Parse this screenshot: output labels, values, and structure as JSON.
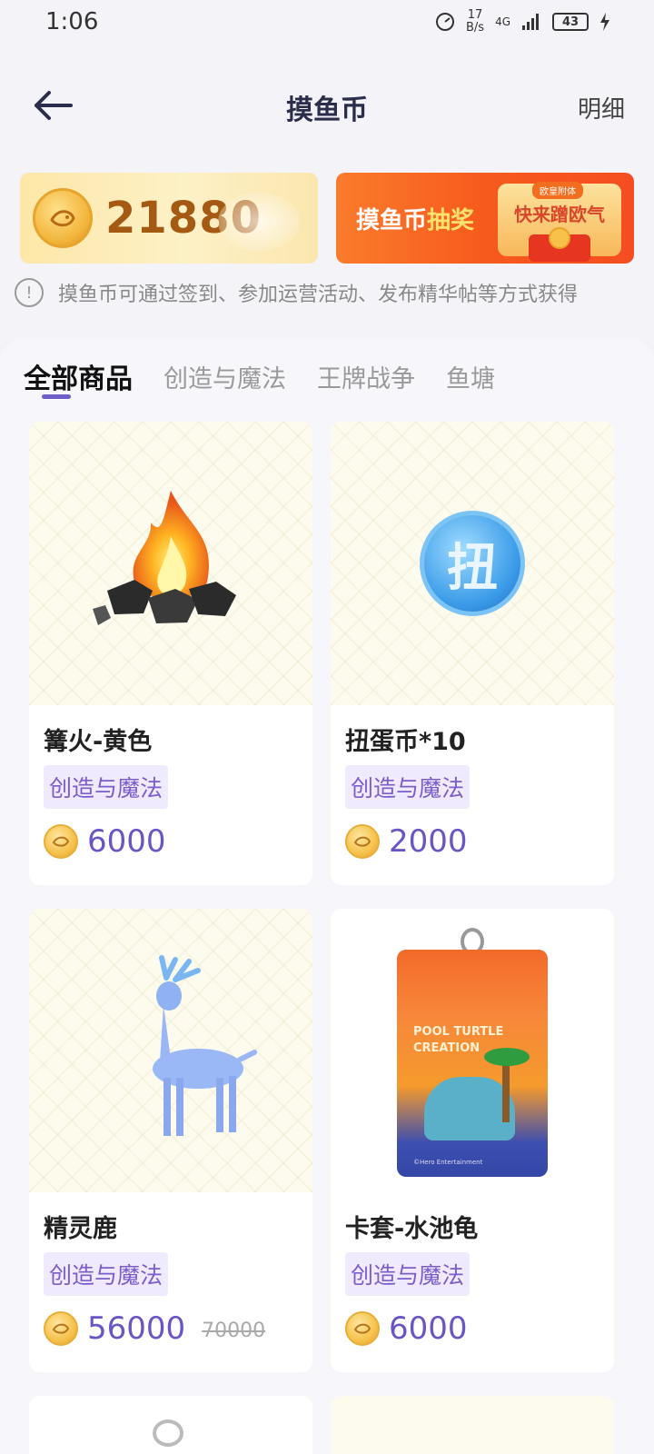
{
  "status_bar": {
    "time": "1:06",
    "speed_value": "17",
    "speed_unit": "B/s",
    "network": "4G",
    "battery": "43"
  },
  "header": {
    "title": "摸鱼币",
    "detail_link": "明细"
  },
  "balance": {
    "amount": "21880"
  },
  "lottery": {
    "title_white": "摸鱼币",
    "title_highlight": "抽奖",
    "subtitle": "快来蹭欧气",
    "tag": "欧皇附体"
  },
  "notice": {
    "text": "摸鱼币可通过签到、参加运营活动、发布精华帖等方式获得"
  },
  "tabs": [
    {
      "label": "全部商品",
      "active": true
    },
    {
      "label": "创造与魔法",
      "active": false
    },
    {
      "label": "王牌战争",
      "active": false
    },
    {
      "label": "鱼塘",
      "active": false
    }
  ],
  "products": [
    {
      "name": "篝火-黄色",
      "tag": "创造与魔法",
      "price": "6000",
      "icon": "campfire-icon"
    },
    {
      "name": "扭蛋币*10",
      "tag": "创造与魔法",
      "price": "2000",
      "icon": "gacha-coin-icon",
      "coin_char": "扭"
    },
    {
      "name": "精灵鹿",
      "tag": "创造与魔法",
      "price": "56000",
      "original_price": "70000",
      "icon": "spirit-deer-icon"
    },
    {
      "name": "卡套-水池龟",
      "tag": "创造与魔法",
      "price": "6000",
      "icon": "card-holder-icon",
      "card_text": "POOL TURTLE CREATION",
      "card_footer": "©Hero Entertainment"
    }
  ],
  "colors": {
    "accent": "#6b55c3",
    "tag_bg": "#efeafd",
    "lottery_orange": "#f65a1c",
    "coin_gold": "#f5c24c"
  }
}
